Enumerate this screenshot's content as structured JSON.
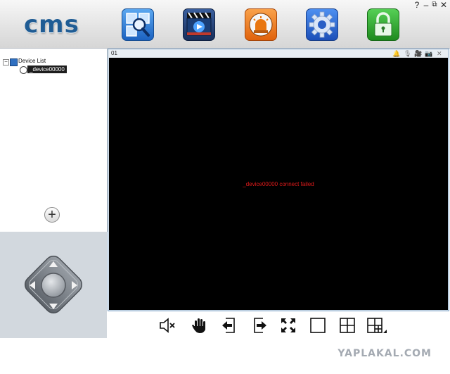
{
  "app": {
    "logo_text": "cms"
  },
  "window_controls": {
    "help": "?",
    "minimize": "–",
    "restore": "⧉",
    "close": "✕"
  },
  "toolbar": {
    "items": [
      {
        "icon": "search-icon",
        "color": "#2d7bd6"
      },
      {
        "icon": "playback-icon",
        "color": "#2f4e89"
      },
      {
        "icon": "alarm-icon",
        "color": "#e8741a"
      },
      {
        "icon": "gear-icon",
        "color": "#2f5fc4"
      },
      {
        "icon": "lock-icon",
        "color": "#2e9a2e"
      }
    ]
  },
  "device_tree": {
    "root_label": "Device List",
    "expander": "⊟",
    "devices": [
      {
        "label": "_device00000"
      }
    ]
  },
  "add_button": {
    "label": "+"
  },
  "video": {
    "channel_label": "01",
    "status_message": "_device00000 connect failed",
    "message_color": "#e21b1b"
  },
  "footer": {
    "watermark": "YAPLAKAL.COM"
  }
}
